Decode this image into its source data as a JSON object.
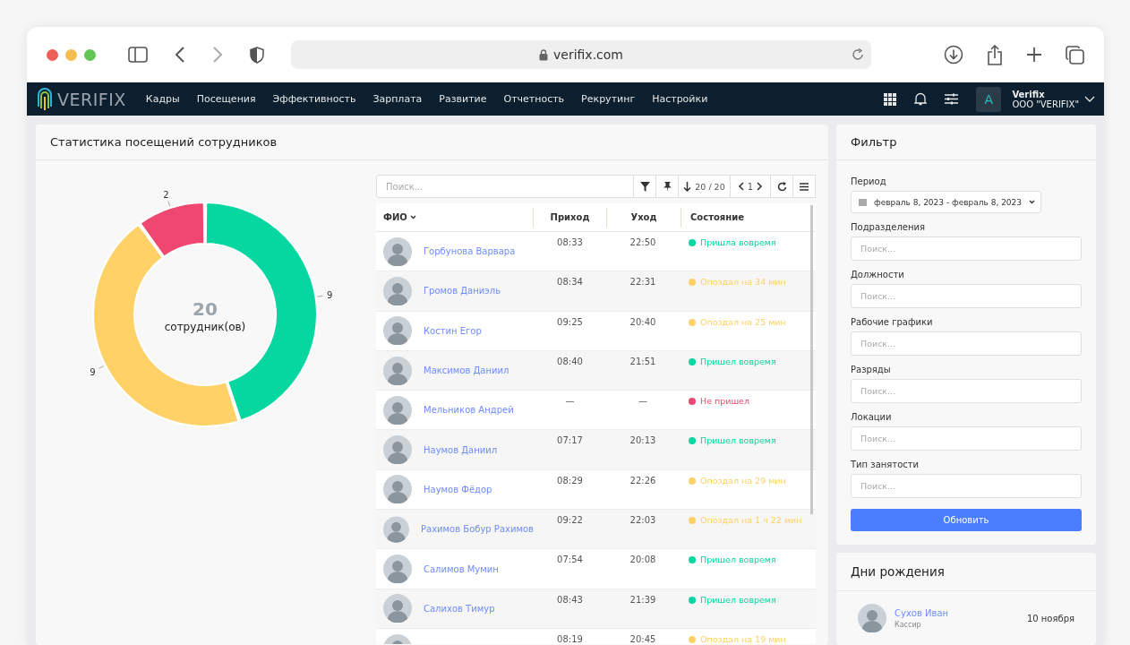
{
  "browser": {
    "url": "verifix.com"
  },
  "navbar": {
    "logo": "VERIFIX",
    "menu": [
      "Кадры",
      "Посещения",
      "Эффективность",
      "Зарплата",
      "Развитие",
      "Отчетность",
      "Рекрутинг",
      "Настройки"
    ],
    "avatar_letter": "A",
    "user_name": "Verifix",
    "company": "ООО \"VERIFIX\""
  },
  "stats_card": {
    "title": "Статистика посещений сотрудников",
    "chart_data": {
      "type": "donut",
      "values": [
        9,
        9,
        2
      ],
      "colors": [
        "#06d6a0",
        "#ffd166",
        "#ef476f"
      ],
      "data_labels": true
    },
    "center_value": "20",
    "center_label": "сотрудник(ов)"
  },
  "table": {
    "search_placeholder": "Поиск...",
    "count": "20 / 20",
    "page": "1",
    "columns": [
      "ФИО",
      "Приход",
      "Уход",
      "Состояние"
    ],
    "rows": [
      {
        "name": "Горбунова Варвара",
        "in": "08:33",
        "out": "22:50",
        "status": "Пришла вовремя",
        "color": "#06d6a0"
      },
      {
        "name": "Громов Даниэль",
        "in": "08:34",
        "out": "22:31",
        "status": "Опоздал на 34 мин",
        "color": "#ffd166"
      },
      {
        "name": "Костин Егор",
        "in": "09:25",
        "out": "20:40",
        "status": "Опоздал на 25 мин",
        "color": "#ffd166"
      },
      {
        "name": "Максимов Даниил",
        "in": "08:40",
        "out": "21:51",
        "status": "Пришел вовремя",
        "color": "#06d6a0"
      },
      {
        "name": "Мельников Андрей",
        "in": "—",
        "out": "—",
        "status": "Не пришел",
        "color": "#ef476f"
      },
      {
        "name": "Наумов Даниил",
        "in": "07:17",
        "out": "20:13",
        "status": "Пришел вовремя",
        "color": "#06d6a0"
      },
      {
        "name": "Наумов Фёдор",
        "in": "08:29",
        "out": "22:26",
        "status": "Опоздал на 29 мин",
        "color": "#ffd166"
      },
      {
        "name": "Рахимов Бобур Рахимов",
        "in": "09:22",
        "out": "22:03",
        "status": "Опоздал на 1 ч 22 мин",
        "color": "#ffd166"
      },
      {
        "name": "Салимов Мумин",
        "in": "07:54",
        "out": "20:08",
        "status": "Пришел вовремя",
        "color": "#06d6a0"
      },
      {
        "name": "Салихов Тимур",
        "in": "08:43",
        "out": "21:39",
        "status": "Пришел вовремя",
        "color": "#06d6a0"
      },
      {
        "in": "08:19",
        "out": "20:45",
        "status": "Опоздал на 19 мин",
        "color": "#ffd166"
      }
    ]
  },
  "filter": {
    "title": "Фильтр",
    "period_label": "Период",
    "period": "февраль 8, 2023 - февраль 8, 2023",
    "fields": [
      {
        "label": "Подразделения",
        "placeholder": "Поиск..."
      },
      {
        "label": "Должности",
        "placeholder": "Поиск..."
      },
      {
        "label": "Рабочие графики",
        "placeholder": "Поиск..."
      },
      {
        "label": "Разряды",
        "placeholder": "Поиск..."
      },
      {
        "label": "Локации",
        "placeholder": "Поиск..."
      },
      {
        "label": "Тип занятости",
        "placeholder": "Поиск..."
      }
    ],
    "button": "Обновить"
  },
  "birthdays": {
    "title": "Дни рождения",
    "items": [
      {
        "name": "Сухов Иван",
        "role": "Кассир",
        "date": "10 ноября"
      }
    ]
  }
}
